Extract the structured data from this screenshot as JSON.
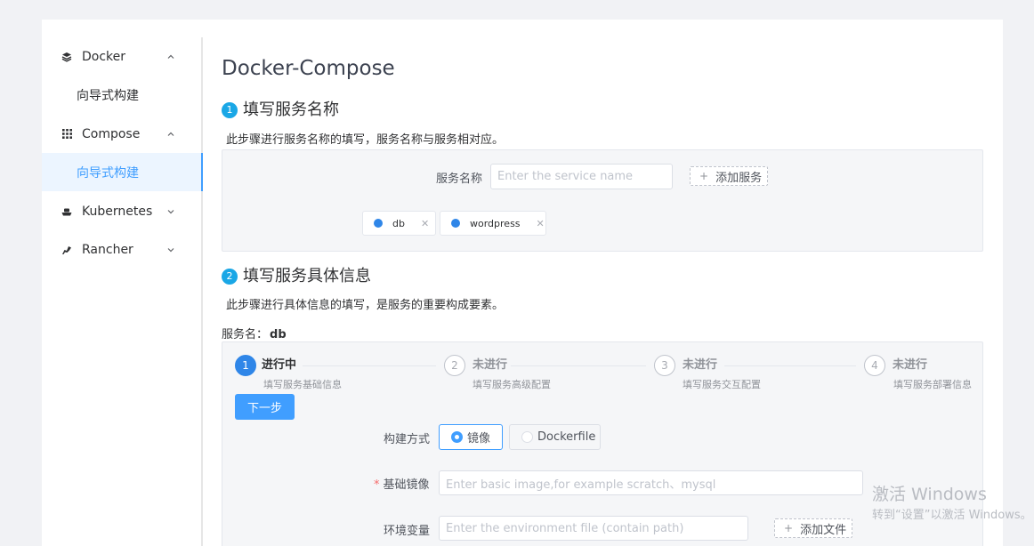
{
  "sidebar": {
    "items": [
      {
        "label": "Docker",
        "icon": "layers-icon",
        "expanded": true,
        "children": [
          {
            "label": "向导式构建",
            "active": false
          }
        ]
      },
      {
        "label": "Compose",
        "icon": "grid-icon",
        "expanded": true,
        "children": [
          {
            "label": "向导式构建",
            "active": true
          }
        ]
      },
      {
        "label": "Kubernetes",
        "icon": "ship-icon",
        "expanded": false
      },
      {
        "label": "Rancher",
        "icon": "rancher-icon",
        "expanded": false
      }
    ]
  },
  "main": {
    "title": "Docker-Compose",
    "step1": {
      "number": "1",
      "title": "填写服务名称",
      "desc": "此步骤进行服务名称的填写，服务名称与服务相对应。",
      "service_name_label": "服务名称",
      "service_name_placeholder": "Enter the service name",
      "add_service_label": "添加服务",
      "tags": [
        "db",
        "wordpress"
      ]
    },
    "step2": {
      "number": "2",
      "title": "填写服务具体信息",
      "desc": "此步骤进行具体信息的填写，是服务的重要构成要素。",
      "service_label": "服务名：",
      "service_value": "db",
      "wizard": [
        {
          "number": "1",
          "title": "进行中",
          "sub": "填写服务基础信息",
          "active": true
        },
        {
          "number": "2",
          "title": "未进行",
          "sub": "填写服务高级配置",
          "active": false
        },
        {
          "number": "3",
          "title": "未进行",
          "sub": "填写服务交互配置",
          "active": false
        },
        {
          "number": "4",
          "title": "未进行",
          "sub": "填写服务部署信息",
          "active": false
        }
      ],
      "next_label": "下一步",
      "build_label": "构建方式",
      "build_options": [
        "镜像",
        "Dockerfile"
      ],
      "build_selected": "镜像",
      "base_image_label": "基础镜像",
      "base_image_placeholder": "Enter basic image,for example scratch、mysql",
      "env_label": "环境变量",
      "env_placeholder": "Enter the environment file (contain path)",
      "add_file_label": "添加文件"
    }
  },
  "watermark": {
    "line1": "激活 Windows",
    "line2": "转到“设置”以激活 Windows。"
  },
  "colors": {
    "accent": "#409eff",
    "step_badge": "#1aa7e6",
    "tag_dot": "#2f86e8"
  }
}
